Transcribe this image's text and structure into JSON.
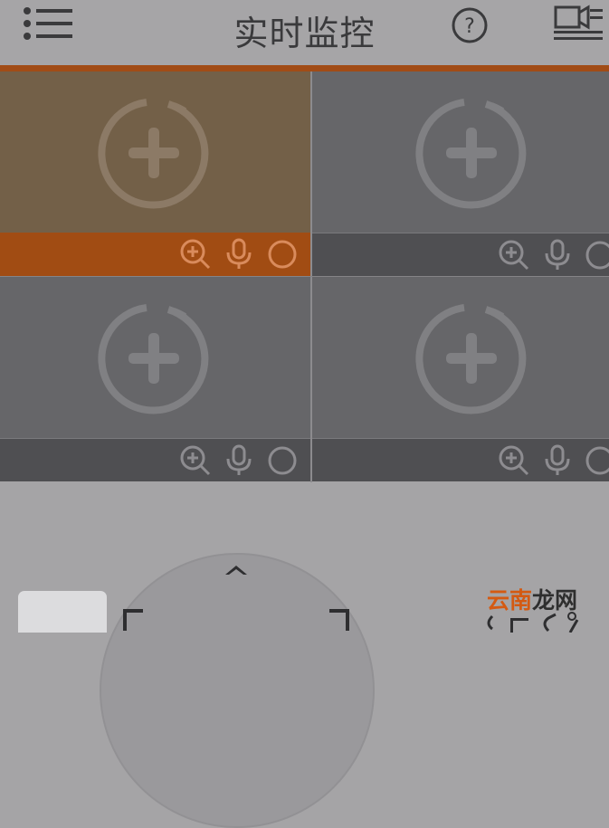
{
  "header": {
    "title": "实时监控",
    "menu_icon": "menu-list-icon",
    "help_icon": "help-icon",
    "camera_icon": "camera-list-icon"
  },
  "colors": {
    "accent": "#a14c16",
    "selected_view": "#736048",
    "view": "#666669",
    "control_bar": "#4f4f52",
    "background": "#a5a4a6",
    "watermark_orange": "#d45a12"
  },
  "grid": {
    "cells": [
      {
        "name": "channel-1",
        "selected": true,
        "add_icon": "add-video-icon",
        "controls": [
          "zoom-in-icon",
          "microphone-icon",
          "record-circle-icon"
        ]
      },
      {
        "name": "channel-2",
        "selected": false,
        "add_icon": "add-video-icon",
        "controls": [
          "zoom-in-icon",
          "microphone-icon",
          "record-circle-icon"
        ]
      },
      {
        "name": "channel-3",
        "selected": false,
        "add_icon": "add-video-icon",
        "controls": [
          "zoom-in-icon",
          "microphone-icon",
          "record-circle-icon"
        ]
      },
      {
        "name": "channel-4",
        "selected": false,
        "add_icon": "add-video-icon",
        "controls": [
          "zoom-in-icon",
          "microphone-icon",
          "record-circle-icon"
        ]
      }
    ]
  },
  "ptz": {
    "up_icon": "chevron-up-icon",
    "corner_icons": [
      "bracket-left-icon",
      "bracket-right-icon"
    ]
  },
  "watermark": {
    "part1": "云南",
    "part2": "龙网"
  }
}
